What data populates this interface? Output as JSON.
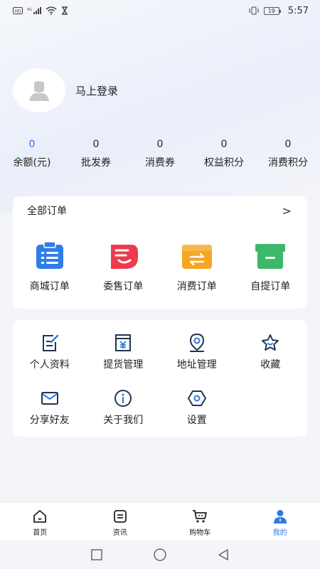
{
  "status_bar": {
    "time": "5:57",
    "battery": "19"
  },
  "profile": {
    "login_label": "马上登录"
  },
  "stats": [
    {
      "value": "0",
      "label": "余额(元)"
    },
    {
      "value": "0",
      "label": "批发券"
    },
    {
      "value": "0",
      "label": "消费券"
    },
    {
      "value": "0",
      "label": "权益积分"
    },
    {
      "value": "0",
      "label": "消费积分"
    }
  ],
  "orders": {
    "title": "全部订单",
    "chevron": ">",
    "items": [
      {
        "label": "商城订单",
        "icon": "clipboard-icon"
      },
      {
        "label": "委售订单",
        "icon": "consign-icon"
      },
      {
        "label": "消费订单",
        "icon": "transfer-box-icon"
      },
      {
        "label": "自提订单",
        "icon": "box-icon"
      }
    ]
  },
  "tools": {
    "items": [
      {
        "label": "个人资料",
        "icon": "edit-icon"
      },
      {
        "label": "提货管理",
        "icon": "pickup-icon"
      },
      {
        "label": "地址管理",
        "icon": "location-icon"
      },
      {
        "label": "收藏",
        "icon": "star-icon"
      },
      {
        "label": "分享好友",
        "icon": "mail-icon"
      },
      {
        "label": "关于我们",
        "icon": "info-icon"
      },
      {
        "label": "设置",
        "icon": "settings-icon"
      }
    ]
  },
  "tabbar": [
    {
      "label": "首页",
      "icon": "home-icon"
    },
    {
      "label": "资讯",
      "icon": "news-icon"
    },
    {
      "label": "购物车",
      "icon": "cart-icon"
    },
    {
      "label": "我的",
      "icon": "user-icon",
      "active": true
    }
  ],
  "colors": {
    "accent": "#2a7ae4",
    "clipboard": "#2f7ee8",
    "consign": "#ee3a4e",
    "transfer": "#f5a623",
    "box": "#3cb86a"
  }
}
